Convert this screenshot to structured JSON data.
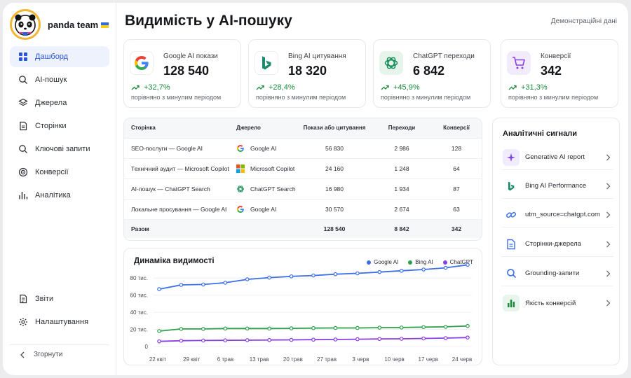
{
  "brand": {
    "name": "panda team"
  },
  "nav": {
    "items": [
      {
        "label": "Дашборд",
        "icon": "grid-icon",
        "active": true
      },
      {
        "label": "AI-пошук",
        "icon": "search-icon"
      },
      {
        "label": "Джерела",
        "icon": "layers-icon"
      },
      {
        "label": "Сторінки",
        "icon": "page-icon"
      },
      {
        "label": "Ключові запити",
        "icon": "search-icon"
      },
      {
        "label": "Конверсії",
        "icon": "target-icon"
      },
      {
        "label": "Аналітика",
        "icon": "bar-chart-icon"
      }
    ],
    "bottom": [
      {
        "label": "Звіти",
        "icon": "report-icon"
      },
      {
        "label": "Налаштування",
        "icon": "gear-icon"
      }
    ],
    "collapse_label": "Згорнути"
  },
  "header": {
    "title": "Видимість у AI-пошуку",
    "demo_label": "Демонстраційні дані"
  },
  "kpis": [
    {
      "label": "Google AI покази",
      "value": "128 540",
      "delta": "+32,7%",
      "note": "порівняно з минулим періодом",
      "icon": "google-icon"
    },
    {
      "label": "Bing AI цитування",
      "value": "18 320",
      "delta": "+28,4%",
      "note": "порівняно з минулим періодом",
      "icon": "bing-icon"
    },
    {
      "label": "ChatGPT переходи",
      "value": "6 842",
      "delta": "+45,9%",
      "note": "порівняно з минулим періодом",
      "icon": "chatgpt-icon"
    },
    {
      "label": "Конверсії",
      "value": "342",
      "delta": "+31,3%",
      "note": "порівняно з минулим періодом",
      "icon": "cart-icon"
    }
  ],
  "table": {
    "headers": [
      "Сторінка",
      "Джерело",
      "Покази або цитування",
      "Переходи",
      "Конверсії"
    ],
    "rows": [
      {
        "page": "SEO-послуги — Google AI",
        "source": "Google AI",
        "source_icon": "google-icon",
        "impressions": "56 830",
        "clicks": "2 986",
        "conversions": "128"
      },
      {
        "page": "Технічний аудит — Microsoft Copilot",
        "source": "Microsoft Copilot",
        "source_icon": "microsoft-icon",
        "impressions": "24 160",
        "clicks": "1 248",
        "conversions": "64"
      },
      {
        "page": "AI-пошук — ChatGPT Search",
        "source": "ChatGPT Search",
        "source_icon": "chatgpt-icon",
        "impressions": "16 980",
        "clicks": "1 934",
        "conversions": "87"
      },
      {
        "page": "Локальне просування — Google AI",
        "source": "Google AI",
        "source_icon": "google-icon",
        "impressions": "30 570",
        "clicks": "2 674",
        "conversions": "63"
      }
    ],
    "total": {
      "label": "Разом",
      "impressions": "128 540",
      "clicks": "8 842",
      "conversions": "342"
    }
  },
  "signals": {
    "title": "Аналітичні сигнали",
    "items": [
      {
        "label": "Generative AI report",
        "icon": "sparkle-icon"
      },
      {
        "label": "Bing AI Performance",
        "icon": "bing-icon"
      },
      {
        "label": "utm_source=chatgpt.com",
        "icon": "link-icon"
      },
      {
        "label": "Сторінки-джерела",
        "icon": "page-icon"
      },
      {
        "label": "Grounding-запити",
        "icon": "search-icon"
      },
      {
        "label": "Якість конверсій",
        "icon": "bar-chart-icon"
      }
    ]
  },
  "colors": {
    "accent": "#2b55d6",
    "positive": "#1e8a3c",
    "google": "#3d6ee8",
    "bing": "#2fa14a",
    "chatgpt": "#8a3fe0"
  },
  "chart_data": {
    "type": "line",
    "title": "Динаміка видимості",
    "x": [
      "22 квіт",
      "29 квіт",
      "6 трав",
      "13 трав",
      "20 трав",
      "27 трав",
      "3 черв",
      "10 черв",
      "17 черв",
      "24 черв"
    ],
    "y_ticks": [
      "0",
      "20 тис.",
      "40 тис.",
      "60 тис.",
      "80 тис."
    ],
    "ylim": [
      0,
      90000
    ],
    "legend_position": "top-right",
    "series": [
      {
        "name": "Google AI",
        "color": "#3d6ee8",
        "values": [
          67000,
          72000,
          72500,
          74500,
          78500,
          80500,
          82000,
          83000,
          84500,
          85500,
          87000,
          88500,
          90000,
          92000,
          95500
        ]
      },
      {
        "name": "Bing AI",
        "color": "#2fa14a",
        "values": [
          18000,
          20500,
          20500,
          21000,
          21000,
          21000,
          21200,
          21500,
          21700,
          21700,
          22000,
          22200,
          22700,
          23000,
          24000
        ]
      },
      {
        "name": "ChatGPT",
        "color": "#8a3fe0",
        "values": [
          6000,
          6800,
          7000,
          7200,
          7400,
          7600,
          7800,
          8000,
          8200,
          8500,
          8800,
          9000,
          9400,
          9800,
          10500
        ]
      }
    ]
  }
}
